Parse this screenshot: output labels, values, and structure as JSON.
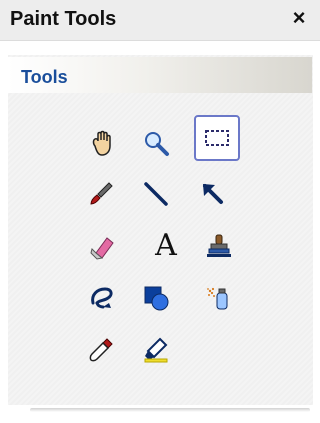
{
  "window": {
    "title": "Paint Tools",
    "close_glyph": "×"
  },
  "section": {
    "title": "Tools"
  },
  "tools": [
    {
      "name": "hand-tool",
      "icon": "hand-icon",
      "selected": false
    },
    {
      "name": "zoom-tool",
      "icon": "magnifier-icon",
      "selected": false
    },
    {
      "name": "marquee-select-tool",
      "icon": "dashed-rectangle-icon",
      "selected": true
    },
    {
      "name": "brush-tool",
      "icon": "brush-icon",
      "selected": false
    },
    {
      "name": "line-tool",
      "icon": "line-icon",
      "selected": false
    },
    {
      "name": "arrow-tool",
      "icon": "arrow-icon",
      "selected": false
    },
    {
      "name": "eraser-tool",
      "icon": "eraser-icon",
      "selected": false
    },
    {
      "name": "text-tool",
      "icon": "text-icon",
      "label": "A",
      "selected": false
    },
    {
      "name": "stamp-tool",
      "icon": "stamp-icon",
      "selected": false
    },
    {
      "name": "lasso-tool",
      "icon": "lasso-icon",
      "selected": false
    },
    {
      "name": "shapes-tool",
      "icon": "shapes-icon",
      "selected": false
    },
    {
      "name": "spray-tool",
      "icon": "spray-can-icon",
      "selected": false
    },
    {
      "name": "eyedropper-tool",
      "icon": "eyedropper-icon",
      "selected": false
    },
    {
      "name": "highlighter-tool",
      "icon": "highlighter-icon",
      "selected": false
    }
  ],
  "colors": {
    "accent_blue": "#1a4e9b",
    "selection_border": "#6b78c8"
  }
}
